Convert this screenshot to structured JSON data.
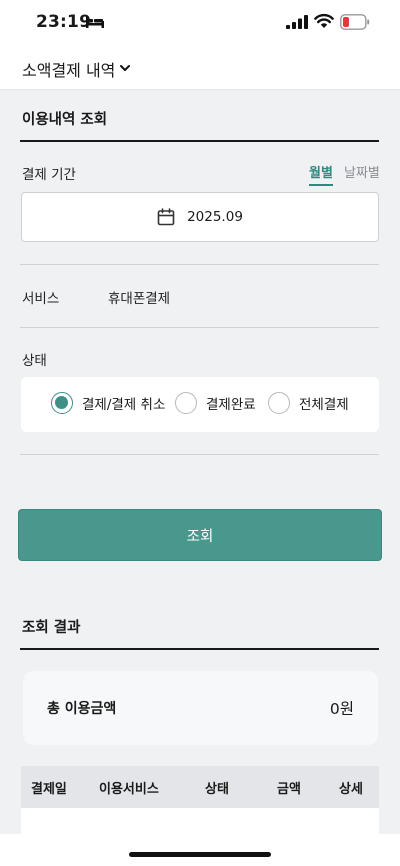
{
  "status_bar": {
    "time": "23:19"
  },
  "header": {
    "title": "소액결제 내역"
  },
  "inquiry": {
    "section_title": "이용내역 조회",
    "period_label": "결제 기간",
    "tabs": [
      {
        "label": "월별",
        "active": true
      },
      {
        "label": "날짜별",
        "active": false
      }
    ],
    "date_value": "2025.09",
    "service_label": "서비스",
    "service_value": "휴대폰결제",
    "status_label": "상태",
    "status_options": [
      {
        "label": "결제/결제 취소",
        "checked": true
      },
      {
        "label": "결제완료",
        "checked": false
      },
      {
        "label": "전체결제",
        "checked": false
      }
    ],
    "search_button": "조회"
  },
  "results": {
    "section_title": "조회 결과",
    "total_label": "총 이용금액",
    "total_value": "0원",
    "columns": [
      "결제일",
      "이용서비스",
      "상태",
      "금액",
      "상세"
    ]
  },
  "colors": {
    "accent": "#4a978d",
    "accent_text": "#2f8a80",
    "battery_low": "#e5393a"
  },
  "icons": [
    "bed-icon",
    "signal-icon",
    "wifi-icon",
    "battery-icon",
    "chevron-down-icon",
    "calendar-icon"
  ]
}
